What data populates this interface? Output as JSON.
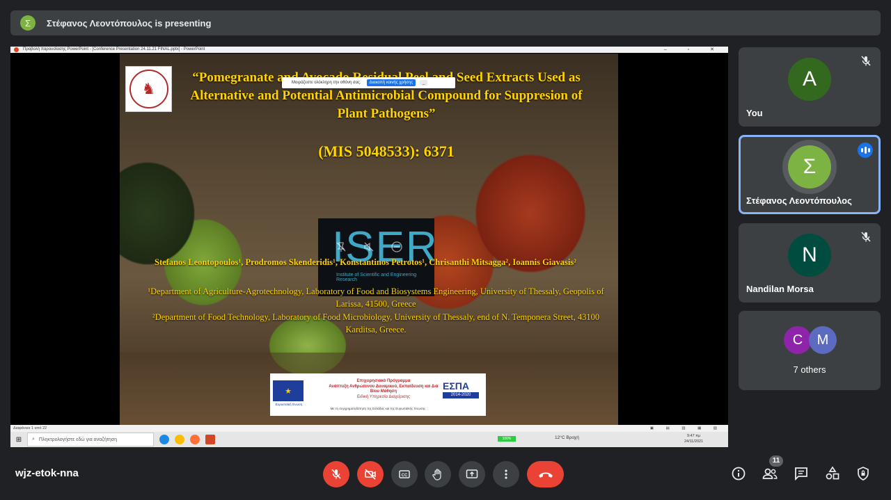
{
  "banner": {
    "avatar_letter": "Σ",
    "text": "Στέφανος Λεοντόπουλος is presenting"
  },
  "presentation": {
    "window_title": "Προβολή παρουσίασης PowerPoint - [Conference Presentation 24.11.21 FINAL.pptx] - PowerPoint",
    "window_controls": "– ▫ ✕",
    "share_bar": {
      "label": "Μοιράζεστε ολόκληρη την οθόνη σας.",
      "stop": "Διακοπή κοινής χρήσης",
      "hide": "_"
    },
    "slide": {
      "title": "“Pomegranate and Avocado Residual Peel and Seed Extracts Used as Alternative and Potential Antimicrobial Compound for Suppresion of Plant Pathogens”",
      "mis": "(MIS 5048533): 6371",
      "iser_logo": "ISER",
      "iser_sub": "Institute of Scientific and Engineering Research",
      "authors": "Stefanos Leontopoulos¹, Prodromos Skenderidis¹, Konstantinos Petrotos¹, Chrisanthi Mitsagga², Ioannis Giavasis²",
      "affil1": "¹Department of Agriculture-Agrotechnology, Laboratory of Food and Biosystems Engineering, University of Thessaly, Geopolis of Larissa, 41500, Greece",
      "affil2": "²Department of Food Technology, Laboratory of Food Microbiology, University of Thessaly, end of N. Temponera Street, 43100 Karditsa, Greece."
    },
    "espa": {
      "eu_caption": "Ευρωπαϊκή Ένωση",
      "program_heading": "Επιχειρησιακό Πρόγραμμα",
      "program_name": "Ανάπτυξη Ανθρώπινου Δυναμικού, Εκπαίδευση και Διά Βίου Μάθηση",
      "program_sub": "Ειδική Υπηρεσία Διαχείρισης",
      "footer": "Με τη συγχρηματοδότηση της Ελλάδας και της Ευρωπαϊκής Ένωσης",
      "logo": "ΕΣΠΑ",
      "years": "2014-2020"
    },
    "status": {
      "left": "Διαφάνεια 1 από 22",
      "right": "▣ ▤ ▥ ▦ ▧"
    },
    "taskbar": {
      "search_placeholder": "Πληκτρολογήστε εδώ για αναζήτηση",
      "zoom": "100%",
      "weather": "12°C Βροχή",
      "time": "9:47 πμ",
      "date": "24/11/2021"
    }
  },
  "participants": [
    {
      "letter": "A",
      "name": "You",
      "color": "#33691e",
      "muted": true
    },
    {
      "letter": "Σ",
      "name": "Στέφανος Λεοντόπουλος",
      "color": "#7cb342",
      "speaking": true
    },
    {
      "letter": "N",
      "name": "Nandilan Morsa",
      "color": "#004d40",
      "muted": true
    }
  ],
  "others": {
    "letters": [
      "C",
      "M"
    ],
    "colors": [
      "#8e24aa",
      "#5c6bc0"
    ],
    "label": "7 others"
  },
  "controls": {
    "meeting_code": "wjz-etok-nna",
    "participant_count": "11",
    "accent_red": "#ea4335"
  }
}
